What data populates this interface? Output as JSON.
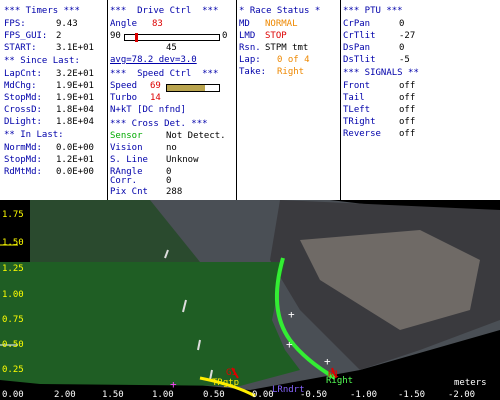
{
  "timers": {
    "header": "*** Timers ***",
    "rows": [
      {
        "label": "FPS:",
        "value": "9.43"
      },
      {
        "label": "FPS_GUI:",
        "value": "2"
      },
      {
        "label": "START:",
        "value": "3.1E+01"
      }
    ],
    "since_header": "** Since Last:",
    "since_rows": [
      {
        "label": "LapCnt:",
        "value": "3.2E+01"
      },
      {
        "label": "MdChg:",
        "value": "1.9E+01"
      },
      {
        "label": "StopMd:",
        "value": "1.9E+01"
      },
      {
        "label": "CrossD:",
        "value": "1.8E+04"
      },
      {
        "label": "DLight:",
        "value": "1.8E+04"
      }
    ],
    "in_header": "** In Last:",
    "in_rows": [
      {
        "label": "NormMd:",
        "value": "0.0E+00"
      },
      {
        "label": "StopMd:",
        "value": "1.2E+01"
      },
      {
        "label": "RdMtMd:",
        "value": "0.0E+00"
      }
    ]
  },
  "drive": {
    "header": "***  Drive Ctrl  ***",
    "angle_label": "Angle",
    "angle_value": "83",
    "scale_left": "90",
    "scale_right": "0",
    "scale_mid": "45",
    "avg_text": "avg=78.2 dev=3.0",
    "speed_header": "***  Speed Ctrl  ***",
    "speed_label": "Speed",
    "speed_value": "69",
    "turbo_label": "Turbo",
    "turbo_value": "14",
    "nkt_text": "N+kT [DC nfnd]",
    "cross_header": "*** Cross Det. ***",
    "cross_rows": [
      {
        "label": "Sensor",
        "value": "Not Detect."
      },
      {
        "label": "Vision",
        "value": "no"
      },
      {
        "label": "S. Line",
        "value": "Unknow"
      },
      {
        "label": "RAngle",
        "value": "0"
      },
      {
        "label": "Corr.",
        "value": "0"
      },
      {
        "label": "Pix Cnt",
        "value": "288"
      }
    ]
  },
  "race": {
    "header": "* Race Status *",
    "rows": [
      {
        "label": "MD",
        "value": "NORMAL"
      },
      {
        "label": "LMD",
        "value": "STOP"
      },
      {
        "label": "Rsn.",
        "value": "STPM tmt"
      },
      {
        "label": "Lap:",
        "value": "0 of 4"
      },
      {
        "label": "Take:",
        "value": "Right"
      }
    ]
  },
  "ptu": {
    "header": "*** PTU ***",
    "rows": [
      {
        "label": "CrPan",
        "value": "0"
      },
      {
        "label": "CrTlit",
        "value": "-27"
      },
      {
        "label": "DsPan",
        "value": "0"
      },
      {
        "label": "DsTlit",
        "value": "-5"
      }
    ],
    "signals_header": "*** SIGNALS **",
    "signals": [
      {
        "label": "Front",
        "value": "off"
      },
      {
        "label": "Tail",
        "value": "off"
      },
      {
        "label": "TLeft",
        "value": "off"
      },
      {
        "label": "TRight",
        "value": "off"
      },
      {
        "label": "Reverse",
        "value": "off"
      }
    ]
  },
  "field": {
    "y_labels": [
      "1.75",
      "1.50",
      "1.25",
      "1.00",
      "0.75",
      "0.50",
      "0.25",
      "0.00"
    ],
    "x_labels": [
      "2.00",
      "1.50",
      "1.00",
      "0.50",
      "0.00",
      "-0.50",
      "-1.00",
      "-1.50",
      "-2.00"
    ],
    "x_unit": "meters",
    "marker_g1": "G1",
    "marker_r1": "R1",
    "trgtp_label": "TRgtp",
    "right_label": "Right",
    "lrndrt_label": "LRndrt"
  }
}
